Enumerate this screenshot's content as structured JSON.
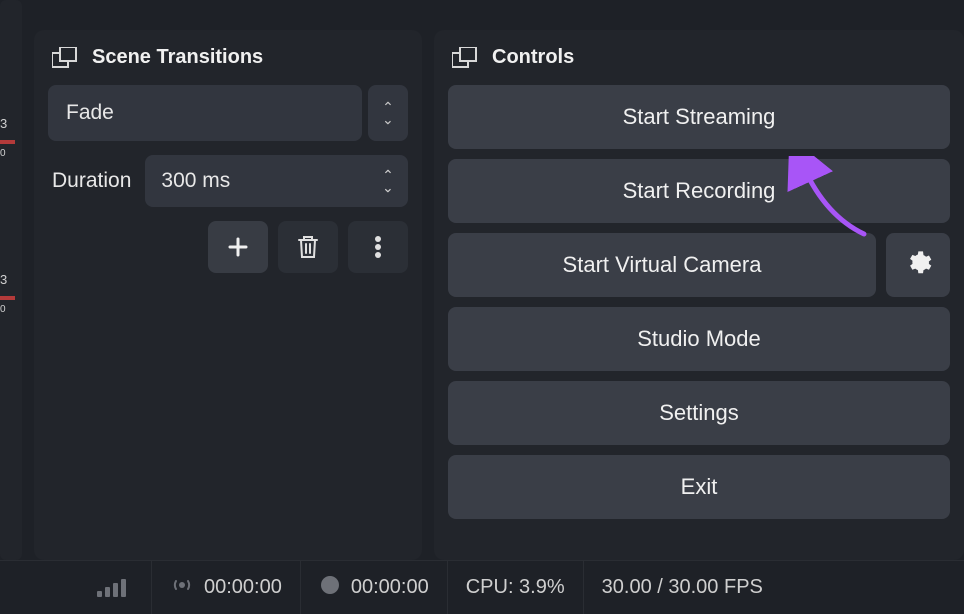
{
  "panels": {
    "transitions": {
      "title": "Scene Transitions",
      "selected_transition": "Fade",
      "duration_label": "Duration",
      "duration_value": "300 ms"
    },
    "controls": {
      "title": "Controls",
      "buttons": {
        "start_streaming": "Start Streaming",
        "start_recording": "Start Recording",
        "start_virtual_camera": "Start Virtual Camera",
        "studio_mode": "Studio Mode",
        "settings": "Settings",
        "exit": "Exit"
      }
    }
  },
  "status_bar": {
    "left_time": "00:00:00",
    "record_time": "00:00:00",
    "cpu": "CPU: 3.9%",
    "fps": "30.00 / 30.00 FPS"
  },
  "left_edge": {
    "mark1": "3",
    "mark2": "0",
    "mark3": "3",
    "mark4": "0"
  }
}
